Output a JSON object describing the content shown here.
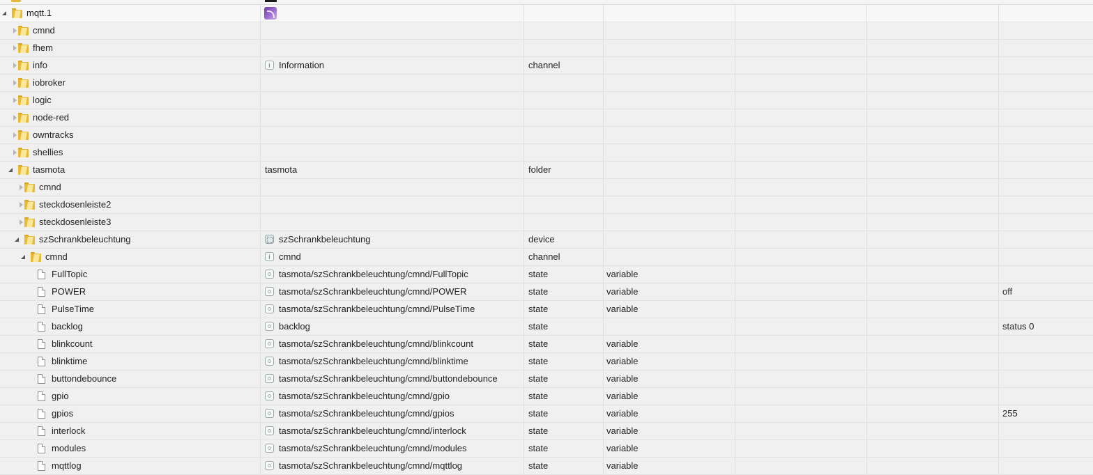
{
  "tree": {
    "rows": [
      {
        "id": "mqtt.1",
        "name": "",
        "type": "",
        "role": "",
        "value": ""
      },
      {
        "id": "cmnd",
        "name": "",
        "type": "",
        "role": "",
        "value": ""
      },
      {
        "id": "fhem",
        "name": "",
        "type": "",
        "role": "",
        "value": ""
      },
      {
        "id": "info",
        "name": "Information",
        "type": "channel",
        "role": "",
        "value": ""
      },
      {
        "id": "iobroker",
        "name": "",
        "type": "",
        "role": "",
        "value": ""
      },
      {
        "id": "logic",
        "name": "",
        "type": "",
        "role": "",
        "value": ""
      },
      {
        "id": "node-red",
        "name": "",
        "type": "",
        "role": "",
        "value": ""
      },
      {
        "id": "owntracks",
        "name": "",
        "type": "",
        "role": "",
        "value": ""
      },
      {
        "id": "shellies",
        "name": "",
        "type": "",
        "role": "",
        "value": ""
      },
      {
        "id": "tasmota",
        "name": "tasmota",
        "type": "folder",
        "role": "",
        "value": ""
      },
      {
        "id": "cmnd",
        "name": "",
        "type": "",
        "role": "",
        "value": ""
      },
      {
        "id": "steckdosenleiste2",
        "name": "",
        "type": "",
        "role": "",
        "value": ""
      },
      {
        "id": "steckdosenleiste3",
        "name": "",
        "type": "",
        "role": "",
        "value": ""
      },
      {
        "id": "szSchrankbeleuchtung",
        "name": "szSchrankbeleuchtung",
        "type": "device",
        "role": "",
        "value": ""
      },
      {
        "id": "cmnd",
        "name": "cmnd",
        "type": "channel",
        "role": "",
        "value": ""
      },
      {
        "id": "FullTopic",
        "name": "tasmota/szSchrankbeleuchtung/cmnd/FullTopic",
        "type": "state",
        "role": "variable",
        "value": ""
      },
      {
        "id": "POWER",
        "name": "tasmota/szSchrankbeleuchtung/cmnd/POWER",
        "type": "state",
        "role": "variable",
        "value": "off"
      },
      {
        "id": "PulseTime",
        "name": "tasmota/szSchrankbeleuchtung/cmnd/PulseTime",
        "type": "state",
        "role": "variable",
        "value": ""
      },
      {
        "id": "backlog",
        "name": "backlog",
        "type": "state",
        "role": "",
        "value": "status 0"
      },
      {
        "id": "blinkcount",
        "name": "tasmota/szSchrankbeleuchtung/cmnd/blinkcount",
        "type": "state",
        "role": "variable",
        "value": ""
      },
      {
        "id": "blinktime",
        "name": "tasmota/szSchrankbeleuchtung/cmnd/blinktime",
        "type": "state",
        "role": "variable",
        "value": ""
      },
      {
        "id": "buttondebounce",
        "name": "tasmota/szSchrankbeleuchtung/cmnd/buttondebounce",
        "type": "state",
        "role": "variable",
        "value": ""
      },
      {
        "id": "gpio",
        "name": "tasmota/szSchrankbeleuchtung/cmnd/gpio",
        "type": "state",
        "role": "variable",
        "value": ""
      },
      {
        "id": "gpios",
        "name": "tasmota/szSchrankbeleuchtung/cmnd/gpios",
        "type": "state",
        "role": "variable",
        "value": "255"
      },
      {
        "id": "interlock",
        "name": "tasmota/szSchrankbeleuchtung/cmnd/interlock",
        "type": "state",
        "role": "variable",
        "value": ""
      },
      {
        "id": "modules",
        "name": "tasmota/szSchrankbeleuchtung/cmnd/modules",
        "type": "state",
        "role": "variable",
        "value": ""
      },
      {
        "id": "mqttlog",
        "name": "tasmota/szSchrankbeleuchtung/cmnd/mqttlog",
        "type": "state",
        "role": "variable",
        "value": ""
      }
    ]
  },
  "icons": {
    "folder": "folder-icon",
    "file": "file-icon",
    "adapter": "mqtt-adapter-icon",
    "channel": "channel-icon",
    "device": "device-icon",
    "state": "state-icon"
  },
  "colors": {
    "folder": "#e8b935",
    "selected_row": "#f7f7f7",
    "background": "#f0f0f0"
  }
}
